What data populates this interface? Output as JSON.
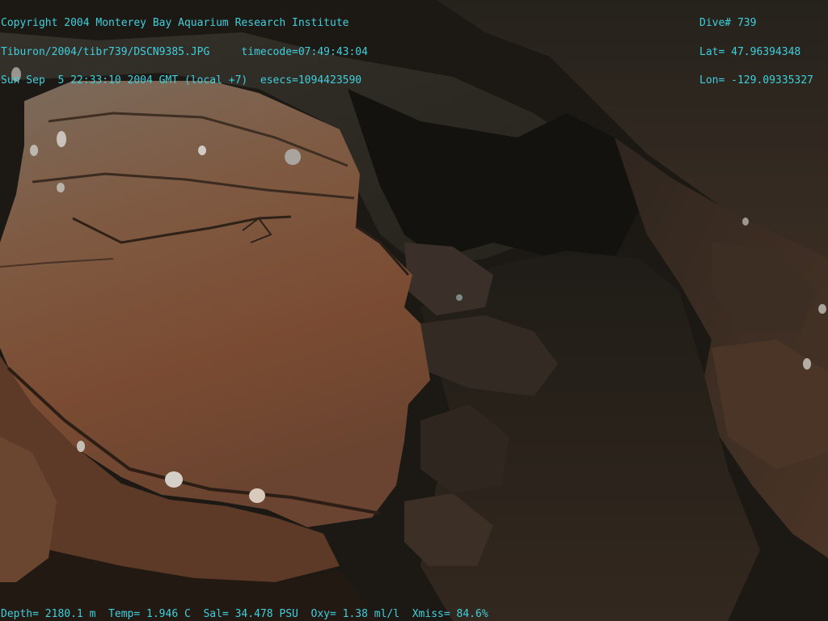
{
  "overlay": {
    "top_left": [
      "Copyright 2004 Monterey Bay Aquarium Research Institute",
      "Tiburon/2004/tibr739/DSCN9385.JPG     timecode=07:49:43:04",
      "Sun Sep  5 22:33:10 2004 GMT (local +7)  esecs=1094423590"
    ],
    "top_right": [
      "Dive# 739",
      "Lat= 47.96394348",
      "Lon= -129.09335327"
    ],
    "bottom": "Depth= 2180.1 m  Temp= 1.946 C  Sal= 34.478 PSU  Oxy= 1.38 ml/l  Xmiss= 84.6%",
    "text_color": "#3fcfdc"
  }
}
